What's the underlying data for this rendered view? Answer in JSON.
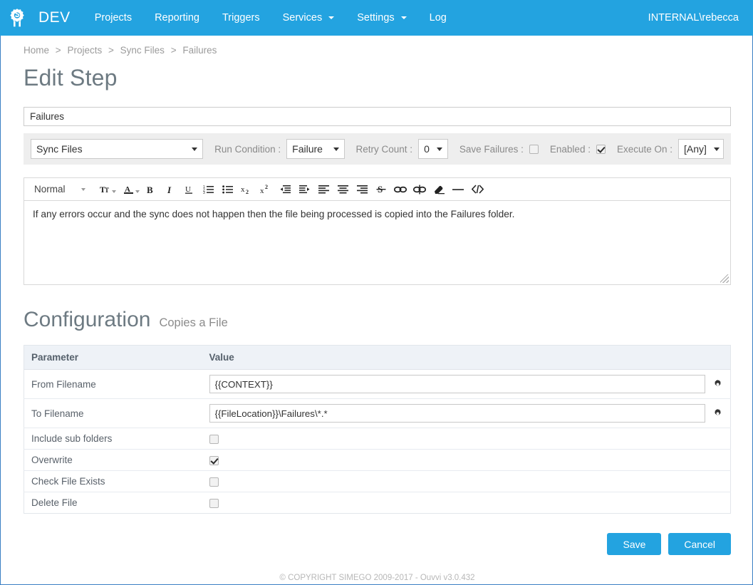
{
  "navbar": {
    "logo_icon": "gear-s-logo-icon",
    "brand": "DEV",
    "links": [
      {
        "label": "Projects",
        "has_caret": false
      },
      {
        "label": "Reporting",
        "has_caret": false
      },
      {
        "label": "Triggers",
        "has_caret": false
      },
      {
        "label": "Services",
        "has_caret": true
      },
      {
        "label": "Settings",
        "has_caret": true
      },
      {
        "label": "Log",
        "has_caret": false
      }
    ],
    "user": "INTERNAL\\rebecca",
    "background_color": "#23a3e0"
  },
  "breadcrumb": {
    "items": [
      "Home",
      "Projects",
      "Sync Files",
      "Failures"
    ],
    "separator": ">"
  },
  "page": {
    "title": "Edit Step"
  },
  "step": {
    "name_value": "Failures",
    "name_placeholder": "",
    "type_select": "Sync Files",
    "run_condition_label": "Run Condition :",
    "run_condition_value": "Failure",
    "retry_count_label": "Retry Count :",
    "retry_count_value": "0",
    "save_failures_label": "Save Failures :",
    "save_failures_checked": false,
    "enabled_label": "Enabled :",
    "enabled_checked": true,
    "execute_on_label": "Execute On :",
    "execute_on_value": "[Any]"
  },
  "editor": {
    "format_label": "Normal",
    "tools": [
      "font-size-icon",
      "text-color-icon",
      "bold-icon",
      "italic-icon",
      "underline-icon",
      "ordered-list-icon",
      "bullet-list-icon",
      "subscript-icon",
      "superscript-icon",
      "outdent-icon",
      "indent-icon",
      "align-left-icon",
      "align-center-icon",
      "align-right-icon",
      "strikethrough-icon",
      "link-icon",
      "unlink-icon",
      "clear-formatting-icon",
      "horizontal-rule-icon",
      "code-icon"
    ],
    "content": "If any errors occur and the sync does not happen then the file being processed is copied into the Failures folder."
  },
  "configuration": {
    "title": "Configuration",
    "subtitle": "Copies a File",
    "columns": [
      "Parameter",
      "Value"
    ],
    "rows": [
      {
        "param": "From Filename",
        "type": "text",
        "value": "{{CONTEXT}}",
        "gear": true
      },
      {
        "param": "To Filename",
        "type": "text",
        "value": "{{FileLocation}}\\Failures\\*.*",
        "gear": true
      },
      {
        "param": "Include sub folders",
        "type": "checkbox",
        "checked": false
      },
      {
        "param": "Overwrite",
        "type": "checkbox",
        "checked": true
      },
      {
        "param": "Check File Exists",
        "type": "checkbox",
        "checked": false
      },
      {
        "param": "Delete File",
        "type": "checkbox",
        "checked": false
      }
    ]
  },
  "actions": {
    "save_label": "Save",
    "cancel_label": "Cancel"
  },
  "footer": {
    "text": "© COPYRIGHT SIMEGO 2009-2017 - Ouvvi v3.0.432"
  }
}
